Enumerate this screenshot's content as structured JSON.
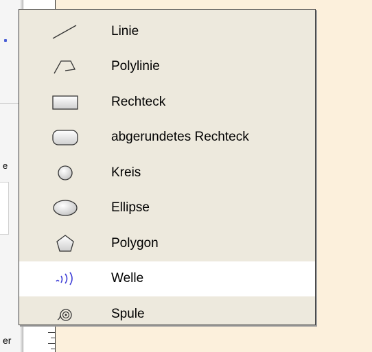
{
  "window": {
    "background_color": "#fcf0dc",
    "fragments": {
      "left_label_1": "e",
      "left_label_2": "er"
    }
  },
  "menu": {
    "background_color": "#ede9dd",
    "highlight_color": "#ffffff",
    "items": [
      {
        "label": "Linie",
        "icon": "line-icon",
        "selected": false
      },
      {
        "label": "Polylinie",
        "icon": "polyline-icon",
        "selected": false
      },
      {
        "label": "Rechteck",
        "icon": "rectangle-icon",
        "selected": false
      },
      {
        "label": "abgerundetes Rechteck",
        "icon": "rounded-rectangle-icon",
        "selected": false
      },
      {
        "label": "Kreis",
        "icon": "circle-icon",
        "selected": false
      },
      {
        "label": "Ellipse",
        "icon": "ellipse-icon",
        "selected": false
      },
      {
        "label": "Polygon",
        "icon": "polygon-icon",
        "selected": false
      },
      {
        "label": "Welle",
        "icon": "wave-icon",
        "selected": true
      },
      {
        "label": "Spule",
        "icon": "coil-icon",
        "selected": false
      }
    ]
  }
}
